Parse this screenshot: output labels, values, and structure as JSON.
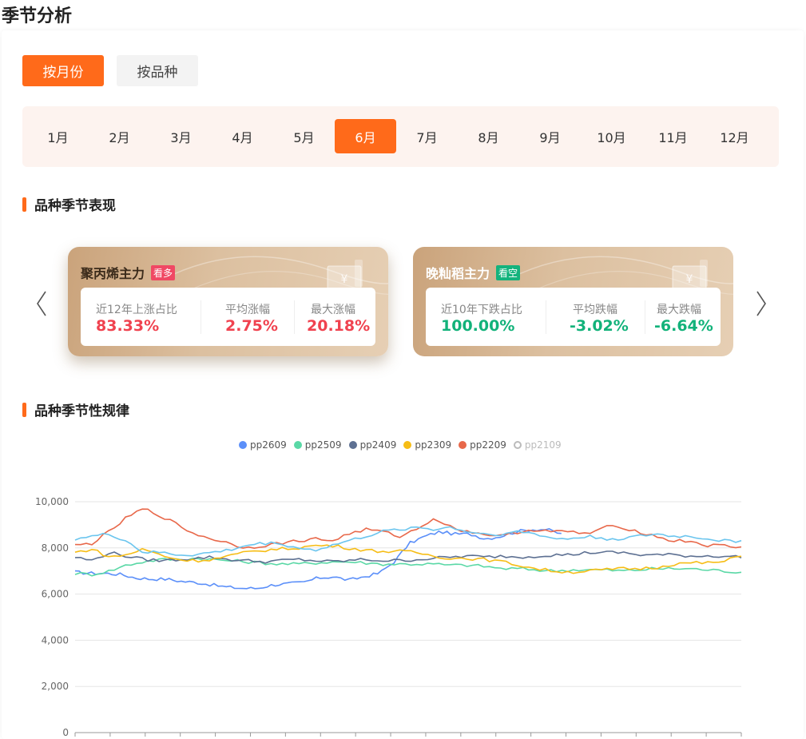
{
  "page_title": "季节分析",
  "mode_tabs": [
    {
      "label": "按月份",
      "active": true
    },
    {
      "label": "按品种",
      "active": false
    }
  ],
  "months": [
    "1月",
    "2月",
    "3月",
    "4月",
    "5月",
    "6月",
    "7月",
    "8月",
    "9月",
    "10月",
    "11月",
    "12月"
  ],
  "active_month": "6月",
  "section_performance": "品种季节表现",
  "section_pattern": "品种季节性规律",
  "cards": [
    {
      "name": "聚丙烯主力",
      "tag": "看多",
      "tag_color": "#f04864",
      "stats": [
        {
          "label": "近12年上涨占比",
          "value": "83.33%"
        },
        {
          "label": "平均涨幅",
          "value": "2.75%"
        },
        {
          "label": "最大涨幅",
          "value": "20.18%"
        }
      ],
      "value_color": "#f0424f",
      "title_color": "#3a2a1a"
    },
    {
      "name": "晚籼稻主力",
      "tag": "看空",
      "tag_color": "#14b37d",
      "stats": [
        {
          "label": "近10年下跌占比",
          "value": "100.00%"
        },
        {
          "label": "平均跌幅",
          "value": "-3.02%"
        },
        {
          "label": "最大跌幅",
          "value": "-6.64%"
        }
      ],
      "value_color": "#12b27a",
      "title_color": "#ffffff"
    }
  ],
  "icons": {
    "prev": "chevron-left-icon",
    "next": "chevron-right-icon",
    "card": "yuan-ticket-icon"
  },
  "chart_data": {
    "type": "line",
    "yticks": [
      "10,000",
      "8,000",
      "6,000",
      "4,000",
      "2,000",
      "0"
    ],
    "ylim": [
      0,
      10000
    ],
    "grid": true,
    "legend_position": "top-center",
    "series": [
      {
        "name": "pp2609",
        "color": "#5b8ff9",
        "active": true,
        "values": [
          6950,
          6900,
          6900,
          6850,
          6700,
          6650,
          6650,
          6550,
          6500,
          6400,
          6300,
          6250,
          6250,
          6400,
          6450,
          6500,
          6700,
          6750,
          6600,
          6750,
          6900,
          7400,
          8200,
          8500,
          8700,
          8600,
          8600,
          8400,
          8500,
          8700,
          8800,
          8800,
          8600
        ]
      },
      {
        "name": "pp2509",
        "color": "#5ad8a6",
        "active": true,
        "values": [
          6900,
          6850,
          7000,
          7250,
          7400,
          7500,
          7500,
          7550,
          7500,
          7450,
          7400,
          7350,
          7300,
          7300,
          7350,
          7400,
          7400,
          7350,
          7300,
          7300,
          7300,
          7300,
          7250,
          7250,
          7200,
          7100,
          7100,
          7050,
          7000,
          7050,
          7050,
          7050,
          7000,
          7050,
          7100,
          7100,
          7100,
          7050,
          7000,
          6950
        ]
      },
      {
        "name": "pp2409",
        "color": "#5d7092",
        "active": true,
        "values": [
          7600,
          7450,
          7800,
          7650,
          7500,
          7450,
          7500,
          7550,
          7600,
          7500,
          7450,
          7400,
          7450,
          7500,
          7450,
          7400,
          7450,
          7500,
          7450,
          7450,
          7500,
          7550,
          7600,
          7650,
          7600,
          7650,
          7600,
          7650,
          7700,
          7700,
          7800,
          7800,
          7800,
          7700,
          7700,
          7700,
          7650,
          7650,
          7650,
          7600
        ]
      },
      {
        "name": "pp2309",
        "color": "#f6bd16",
        "active": true,
        "values": [
          7800,
          7950,
          7600,
          7700,
          7950,
          7700,
          7500,
          7450,
          7500,
          7650,
          7800,
          7900,
          7950,
          8000,
          8100,
          8100,
          8000,
          7900,
          7850,
          7850,
          7800,
          7650,
          7550,
          7550,
          7500,
          7400,
          7250,
          7100,
          7000,
          6950,
          7000,
          7050,
          7100,
          7100,
          7150,
          7300,
          7350,
          7350,
          7400,
          7700
        ]
      },
      {
        "name": "pp2209",
        "color": "#e8684a",
        "active": true,
        "values": [
          8100,
          8200,
          8700,
          9300,
          9700,
          9400,
          9000,
          8600,
          8400,
          8200,
          8000,
          8100,
          8200,
          8300,
          8400,
          8300,
          8600,
          8800,
          8700,
          8500,
          8800,
          9300,
          8900,
          8700,
          8600,
          8500,
          8700,
          8800,
          8700,
          8700,
          8600,
          8900,
          8900,
          8700,
          8500,
          8300,
          8300,
          8100,
          8100,
          8000
        ]
      },
      {
        "name": "pp2109",
        "color": "#bbbbbb",
        "active": false,
        "values": [
          8400,
          8500,
          8600,
          8300,
          7800,
          7800,
          7700,
          7700,
          7800,
          7900,
          8100,
          8200,
          8200,
          8000,
          7900,
          8100,
          8300,
          8500,
          8700,
          8800,
          8900,
          8800,
          8900,
          8700,
          8600,
          8600,
          8700,
          8600,
          8400,
          8400,
          8500,
          8400,
          8400,
          8500,
          8600,
          8500,
          8500,
          8400,
          8300,
          8300
        ]
      }
    ],
    "visible_series_color_override": {
      "pp2109_line": "#6bc5ee"
    }
  }
}
